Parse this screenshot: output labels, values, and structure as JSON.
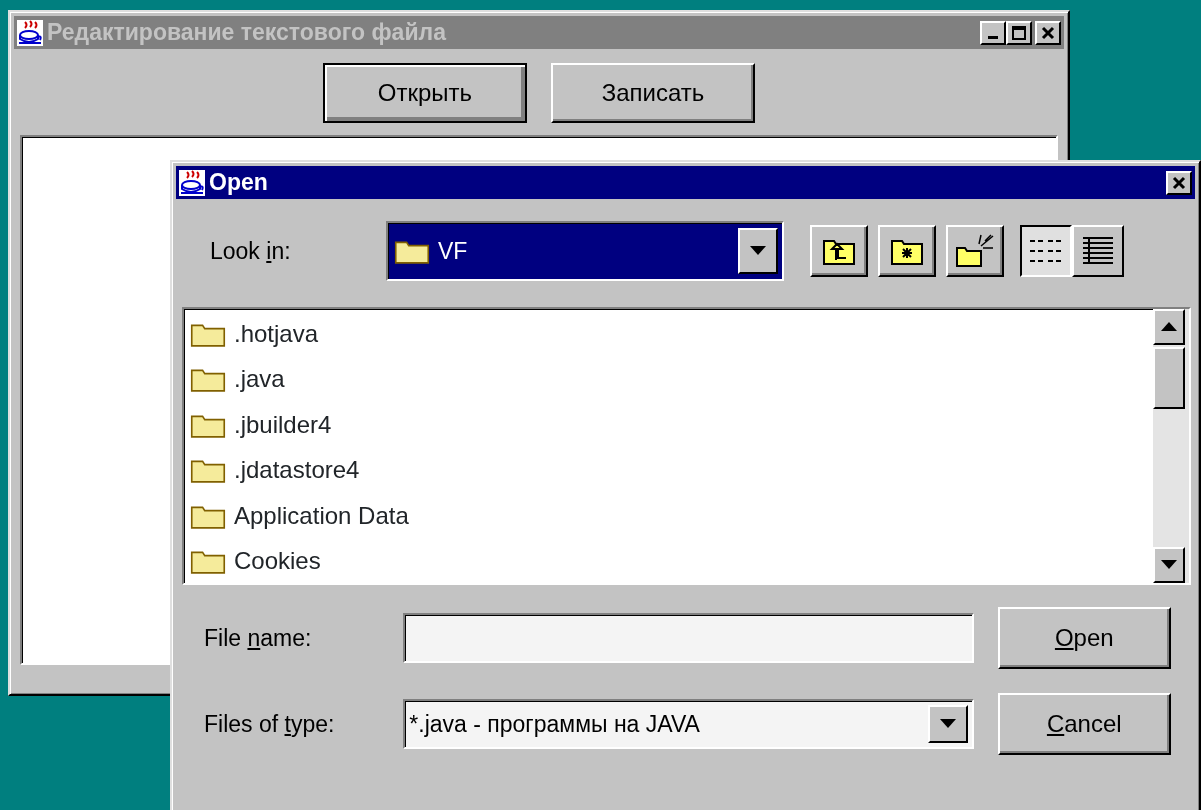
{
  "main_window": {
    "title": "Редактирование текстового файла",
    "active": false,
    "buttons": [
      {
        "label": "Открыть",
        "focused": true
      },
      {
        "label": "Записать",
        "focused": false
      }
    ]
  },
  "dialog": {
    "title": "Open",
    "active": true,
    "look_in": {
      "label": {
        "before": "Look ",
        "key": "i",
        "after": "n:"
      },
      "value": "VF"
    },
    "view_buttons": [
      {
        "kind": "list",
        "selected": true
      },
      {
        "kind": "details",
        "selected": false
      }
    ],
    "files": [
      {
        "name": ".hotjava"
      },
      {
        "name": ".java"
      },
      {
        "name": ".jbuilder4"
      },
      {
        "name": ".jdatastore4"
      },
      {
        "name": "Application Data"
      },
      {
        "name": "Cookies"
      }
    ],
    "file_name": {
      "label": {
        "before": "File ",
        "key": "n",
        "after": "ame:"
      }
    },
    "file_type": {
      "label": {
        "before": "Files of ",
        "key": "t",
        "after": "ype:"
      },
      "value": "*.java - программы на JAVA"
    },
    "buttons": [
      {
        "label": {
          "key": "O",
          "after": "pen"
        }
      },
      {
        "label": {
          "key": "C",
          "after": "ancel"
        }
      }
    ]
  }
}
